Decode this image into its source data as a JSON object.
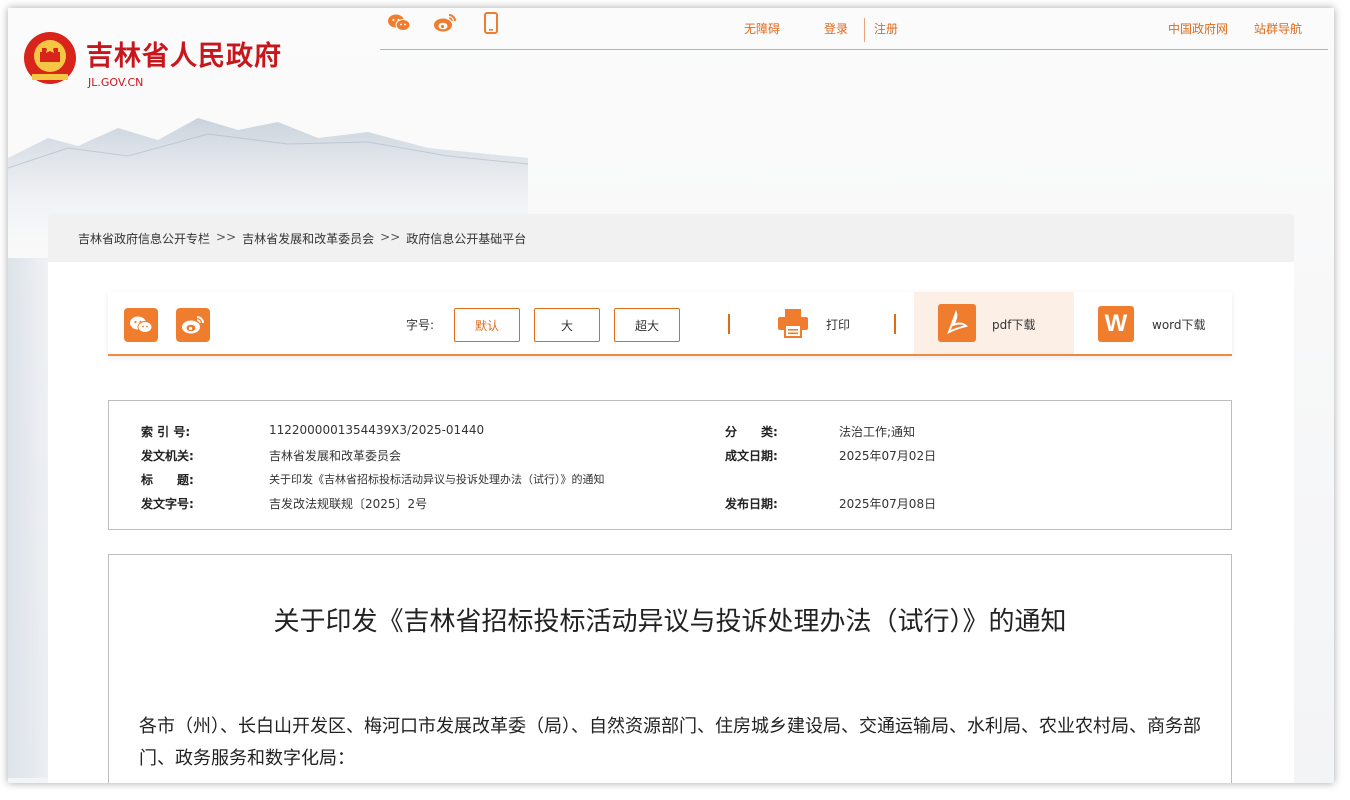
{
  "site": {
    "title": "吉林省人民政府",
    "domain": "JL.GOV.CN"
  },
  "top_links": {
    "accessibility": "无障碍",
    "login": "登录",
    "register": "注册",
    "gov_portal": "中国政府网",
    "site_nav": "站群导航"
  },
  "top_icons": [
    "wechat-icon",
    "weibo-icon",
    "mobile-icon"
  ],
  "breadcrumb": [
    "吉林省政府信息公开专栏",
    "吉林省发展和改革委员会",
    "政府信息公开基础平台"
  ],
  "breadcrumb_sep": ">>",
  "toolbar": {
    "font_size_label": "字号:",
    "font_default": "默认",
    "font_large": "大",
    "font_xlarge": "超大",
    "print": "打印",
    "pdf": "pdf下载",
    "word": "word下载",
    "word_icon_letter": "W"
  },
  "meta": {
    "index_label": "索 引 号:",
    "index_value": "1122000001354439X3/2025-01440",
    "category_label": "分　　类:",
    "category_value": "法治工作;通知",
    "issuer_label": "发文机关:",
    "issuer_value": "吉林省发展和改革委员会",
    "written_date_label": "成文日期:",
    "written_date_value": "2025年07月02日",
    "title_label": "标　　题:",
    "title_value": "关于印发《吉林省招标投标活动异议与投诉处理办法（试行）》的通知",
    "doc_number_label": "发文字号:",
    "doc_number_value": "吉发改法规联规〔2025〕2号",
    "publish_date_label": "发布日期:",
    "publish_date_value": "2025年07月08日"
  },
  "document": {
    "title": "关于印发《吉林省招标投标活动异议与投诉处理办法（试行）》的通知",
    "body": "各市（州）、长白山开发区、梅河口市发展改革委（局）、自然资源部门、住房城乡建设局、交通运输局、水利局、农业农村局、商务部门、政务服务和数字化局："
  },
  "colors": {
    "brand_red": "#c8161d",
    "accent_orange": "#f07d2d"
  }
}
